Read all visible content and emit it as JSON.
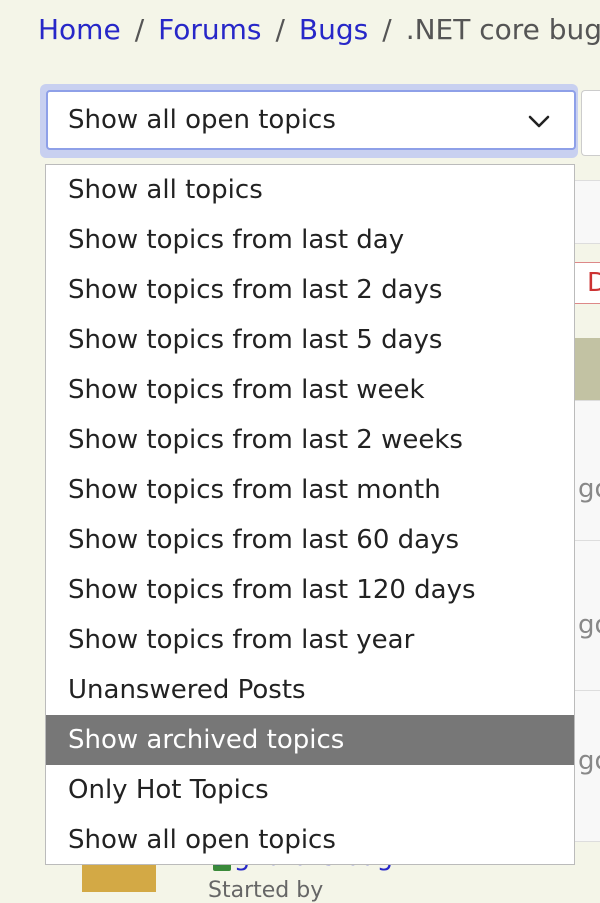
{
  "breadcrumb": {
    "items": [
      "Home",
      "Forums",
      "Bugs"
    ],
    "separator": "/",
    "current": ".NET core bug"
  },
  "filter_select": {
    "value": "Show all open topics",
    "options": [
      "Show all topics",
      "Show topics from last day",
      "Show topics from last 2 days",
      "Show topics from last 5 days",
      "Show topics from last week",
      "Show topics from last 2 weeks",
      "Show topics from last month",
      "Show topics from last 60 days",
      "Show topics from last 120 days",
      "Show topics from last year",
      "Unanswered Posts",
      "Show archived topics",
      "Only Hot Topics",
      "Show all open topics"
    ],
    "highlighted_option": "Show archived topics"
  },
  "background": {
    "tab_fragment": "D",
    "row_fragment": "go",
    "topic_link": "Signature bug!!!",
    "topic_meta": "Started by"
  },
  "colors": {
    "link": "#2727c8",
    "page_background": "#f4f5e8",
    "highlight": "#777777",
    "focus_ring": "#8ea0e8"
  },
  "icons": {
    "select_toggle": "chevron-down-icon"
  }
}
